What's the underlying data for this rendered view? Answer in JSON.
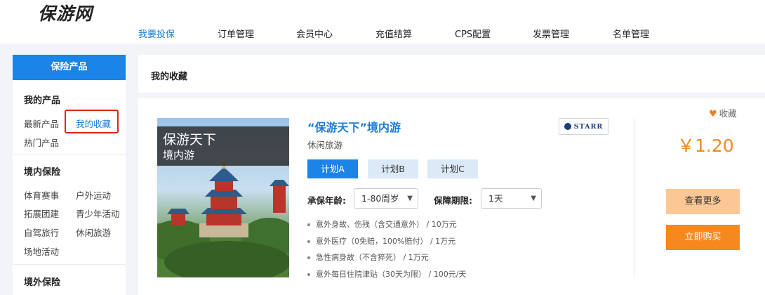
{
  "header": {
    "logo": "保游网",
    "nav": [
      "我要投保",
      "订单管理",
      "会员中心",
      "充值结算",
      "CPS配置",
      "发票管理",
      "名单管理"
    ]
  },
  "sidebar": {
    "title": "保险产品",
    "groups": [
      {
        "title": "我的产品",
        "items": [
          "最新产品",
          "我的收藏",
          "热门产品"
        ]
      },
      {
        "title": "境内保险",
        "items": [
          "体育赛事",
          "户外运动",
          "拓展团建",
          "青少年活动",
          "自驾旅行",
          "休闲旅游",
          "场地活动"
        ]
      },
      {
        "title": "境外保险",
        "items": []
      }
    ]
  },
  "breadcrumb": "我的收藏",
  "product": {
    "image_title": "保游天下",
    "image_subtitle": "境内游",
    "title": "“保游天下”境内游",
    "category": "休闲旅游",
    "insurer_logo": "STARR",
    "plans": [
      "计划A",
      "计划B",
      "计划C"
    ],
    "age_label": "承保年龄:",
    "age_value": "1-80周岁",
    "period_label": "保障期限:",
    "period_value": "1天",
    "benefits": [
      "意外身故、伤残（含交通意外） / 10万元",
      "意外医疗（0免赔，100%赔付） / 1万元",
      "急性病身故（不含猝死） / 1万元",
      "意外每日住院津贴（30天为限） / 100元/天"
    ],
    "favorite_label": "收藏",
    "price": "￥1.20",
    "more_button": "查看更多",
    "buy_button": "立即购买"
  },
  "colors": {
    "primary": "#1a84e8",
    "accent": "#f5891f",
    "selection_box": "#e0231d"
  }
}
